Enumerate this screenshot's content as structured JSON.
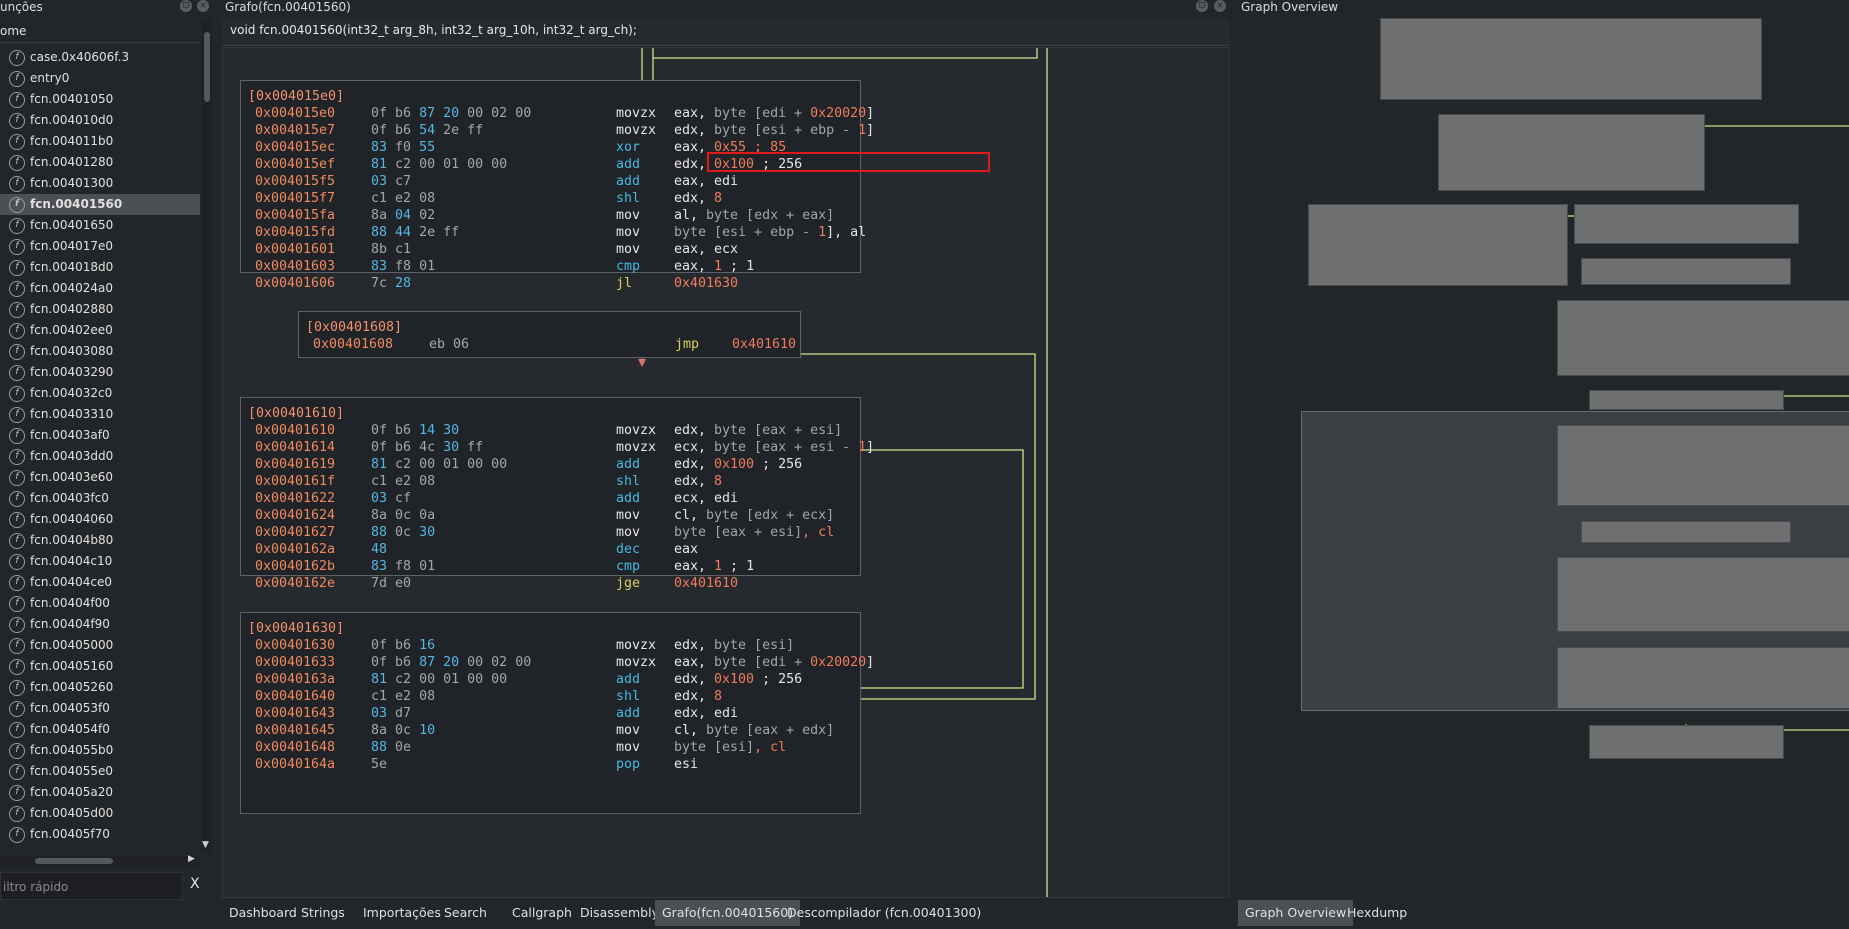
{
  "functions_panel": {
    "title": "unções",
    "header": "ome",
    "items": [
      "case.0x40606f.3",
      "entry0",
      "fcn.00401050",
      "fcn.004010d0",
      "fcn.004011b0",
      "fcn.00401280",
      "fcn.00401300",
      "fcn.00401560",
      "fcn.00401650",
      "fcn.004017e0",
      "fcn.004018d0",
      "fcn.004024a0",
      "fcn.00402880",
      "fcn.00402ee0",
      "fcn.00403080",
      "fcn.00403290",
      "fcn.004032c0",
      "fcn.00403310",
      "fcn.00403af0",
      "fcn.00403dd0",
      "fcn.00403e60",
      "fcn.00403fc0",
      "fcn.00404060",
      "fcn.00404b80",
      "fcn.00404c10",
      "fcn.00404ce0",
      "fcn.00404f00",
      "fcn.00404f90",
      "fcn.00405000",
      "fcn.00405160",
      "fcn.00405260",
      "fcn.004053f0",
      "fcn.004054f0",
      "fcn.004055b0",
      "fcn.004055e0",
      "fcn.00405a20",
      "fcn.00405d00",
      "fcn.00405f70"
    ],
    "selected_index": 7,
    "filter_placeholder": "iltro rápido",
    "clear_label": "X"
  },
  "graph_panel": {
    "title": "Grafo(fcn.00401560)",
    "signature": "void fcn.00401560(int32_t arg_8h, int32_t arg_10h, int32_t arg_ch);",
    "blocks": [
      {
        "label": "[0x004015e0]",
        "rows": [
          {
            "addr": "0x004015e0",
            "bytes": [
              "0f",
              "b6",
              "87",
              "20",
              "00",
              "02",
              "00"
            ],
            "mn": "movzx",
            "op": [
              "eax, ",
              "byte [edi + ",
              "0x20020",
              "]"
            ]
          },
          {
            "addr": "0x004015e7",
            "bytes": [
              "0f",
              "b6",
              "54",
              "2e",
              "ff"
            ],
            "mn": "movzx",
            "op": [
              "edx, ",
              "byte [esi + ebp - ",
              "1",
              "]"
            ]
          },
          {
            "addr": "0x004015ec",
            "bytes": [
              "83",
              "f0",
              "55"
            ],
            "mn": "xor",
            "op": [
              "eax, ",
              "",
              "0x55 ; 85",
              ""
            ]
          },
          {
            "addr": "0x004015ef",
            "bytes": [
              "81",
              "c2",
              "00",
              "01",
              "00",
              "00"
            ],
            "mn": "add",
            "op": [
              "edx, ",
              "",
              "0x100",
              " ; 256"
            ]
          },
          {
            "addr": "0x004015f5",
            "bytes": [
              "03",
              "c7"
            ],
            "mn": "add",
            "op": [
              "eax, edi",
              "",
              "",
              ""
            ]
          },
          {
            "addr": "0x004015f7",
            "bytes": [
              "c1",
              "e2",
              "08"
            ],
            "mn": "shl",
            "op": [
              "edx, ",
              "",
              "8",
              ""
            ]
          },
          {
            "addr": "0x004015fa",
            "bytes": [
              "8a",
              "04",
              "02"
            ],
            "mn": "mov",
            "op": [
              "al, ",
              "byte [edx + eax]",
              "",
              ""
            ]
          },
          {
            "addr": "0x004015fd",
            "bytes": [
              "88",
              "44",
              "2e",
              "ff"
            ],
            "mn": "mov",
            "op": [
              "",
              "byte [esi + ebp - ",
              "1",
              "], al"
            ]
          },
          {
            "addr": "0x00401601",
            "bytes": [
              "8b",
              "c1"
            ],
            "mn": "mov",
            "op": [
              "eax, ecx",
              "",
              "",
              ""
            ]
          },
          {
            "addr": "0x00401603",
            "bytes": [
              "83",
              "f8",
              "01"
            ],
            "mn": "cmp",
            "op": [
              "eax, ",
              "",
              "1",
              " ; 1"
            ]
          },
          {
            "addr": "0x00401606",
            "bytes": [
              "7c",
              "28"
            ],
            "mn": "jl",
            "op": [
              "",
              "",
              "0x401630",
              ""
            ]
          }
        ]
      },
      {
        "label": "[0x00401608]",
        "rows": [
          {
            "addr": "0x00401608",
            "bytes": [
              "eb",
              "06"
            ],
            "mn": "jmp",
            "op": [
              "",
              "",
              "0x401610",
              ""
            ]
          }
        ]
      },
      {
        "label": "[0x00401610]",
        "rows": [
          {
            "addr": "0x00401610",
            "bytes": [
              "0f",
              "b6",
              "14",
              "30"
            ],
            "mn": "movzx",
            "op": [
              "edx, ",
              "byte [eax + esi]",
              "",
              ""
            ]
          },
          {
            "addr": "0x00401614",
            "bytes": [
              "0f",
              "b6",
              "4c",
              "30",
              "ff"
            ],
            "mn": "movzx",
            "op": [
              "ecx, ",
              "byte [eax + esi - ",
              "1",
              "]"
            ]
          },
          {
            "addr": "0x00401619",
            "bytes": [
              "81",
              "c2",
              "00",
              "01",
              "00",
              "00"
            ],
            "mn": "add",
            "op": [
              "edx, ",
              "",
              "0x100",
              " ; 256"
            ]
          },
          {
            "addr": "0x0040161f",
            "bytes": [
              "c1",
              "e2",
              "08"
            ],
            "mn": "shl",
            "op": [
              "edx, ",
              "",
              "8",
              ""
            ]
          },
          {
            "addr": "0x00401622",
            "bytes": [
              "03",
              "cf"
            ],
            "mn": "add",
            "op": [
              "ecx, edi",
              "",
              "",
              ""
            ]
          },
          {
            "addr": "0x00401624",
            "bytes": [
              "8a",
              "0c",
              "0a"
            ],
            "mn": "mov",
            "op": [
              "cl, ",
              "byte [edx + ecx]",
              "",
              ""
            ]
          },
          {
            "addr": "0x00401627",
            "bytes": [
              "88",
              "0c",
              "30"
            ],
            "mn": "mov",
            "op": [
              "",
              "byte [eax + esi]",
              ", cl",
              ""
            ]
          },
          {
            "addr": "0x0040162a",
            "bytes": [
              "48"
            ],
            "mn": "dec",
            "op": [
              "eax",
              "",
              "",
              ""
            ]
          },
          {
            "addr": "0x0040162b",
            "bytes": [
              "83",
              "f8",
              "01"
            ],
            "mn": "cmp",
            "op": [
              "eax, ",
              "",
              "1",
              " ; 1"
            ]
          },
          {
            "addr": "0x0040162e",
            "bytes": [
              "7d",
              "e0"
            ],
            "mn": "jge",
            "op": [
              "",
              "",
              "0x401610",
              ""
            ]
          }
        ]
      },
      {
        "label": "[0x00401630]",
        "rows": [
          {
            "addr": "0x00401630",
            "bytes": [
              "0f",
              "b6",
              "16"
            ],
            "mn": "movzx",
            "op": [
              "edx, ",
              "byte [esi]",
              "",
              ""
            ]
          },
          {
            "addr": "0x00401633",
            "bytes": [
              "0f",
              "b6",
              "87",
              "20",
              "00",
              "02",
              "00"
            ],
            "mn": "movzx",
            "op": [
              "eax, ",
              "byte [edi + ",
              "0x20020",
              "]"
            ]
          },
          {
            "addr": "0x0040163a",
            "bytes": [
              "81",
              "c2",
              "00",
              "01",
              "00",
              "00"
            ],
            "mn": "add",
            "op": [
              "edx, ",
              "",
              "0x100",
              " ; 256"
            ]
          },
          {
            "addr": "0x00401640",
            "bytes": [
              "c1",
              "e2",
              "08"
            ],
            "mn": "shl",
            "op": [
              "edx, ",
              "",
              "8",
              ""
            ]
          },
          {
            "addr": "0x00401643",
            "bytes": [
              "03",
              "d7"
            ],
            "mn": "add",
            "op": [
              "edx, edi",
              "",
              "",
              ""
            ]
          },
          {
            "addr": "0x00401645",
            "bytes": [
              "8a",
              "0c",
              "10"
            ],
            "mn": "mov",
            "op": [
              "cl, ",
              "byte [eax + edx]",
              "",
              ""
            ]
          },
          {
            "addr": "0x00401648",
            "bytes": [
              "88",
              "0e"
            ],
            "mn": "mov",
            "op": [
              "",
              "byte [esi]",
              ", cl",
              ""
            ]
          },
          {
            "addr": "0x0040164a",
            "bytes": [
              "5e"
            ],
            "mn": "pop",
            "op": [
              "esi",
              "",
              "",
              ""
            ]
          }
        ]
      }
    ]
  },
  "overview_panel": {
    "title": "Graph Overview"
  },
  "tabs_left": [
    "Dashboard",
    "Strings",
    "Importações",
    "Search",
    "Callgraph",
    "Disassembly",
    "Grafo(fcn.00401560)",
    "Descompilador (fcn.00401300)"
  ],
  "tabs_left_active": 6,
  "tabs_right": [
    "Graph Overview",
    "Hexdump"
  ],
  "tabs_right_active": 0,
  "colors": {
    "background": "#232629",
    "edge_true": "#c8e68a",
    "edge_false": "#e07070",
    "highlight_box": "#e0191b",
    "address": "#ef8a5e",
    "mnemonic_blue": "#47b8e0",
    "mnemonic_jump": "#d9d05a"
  }
}
